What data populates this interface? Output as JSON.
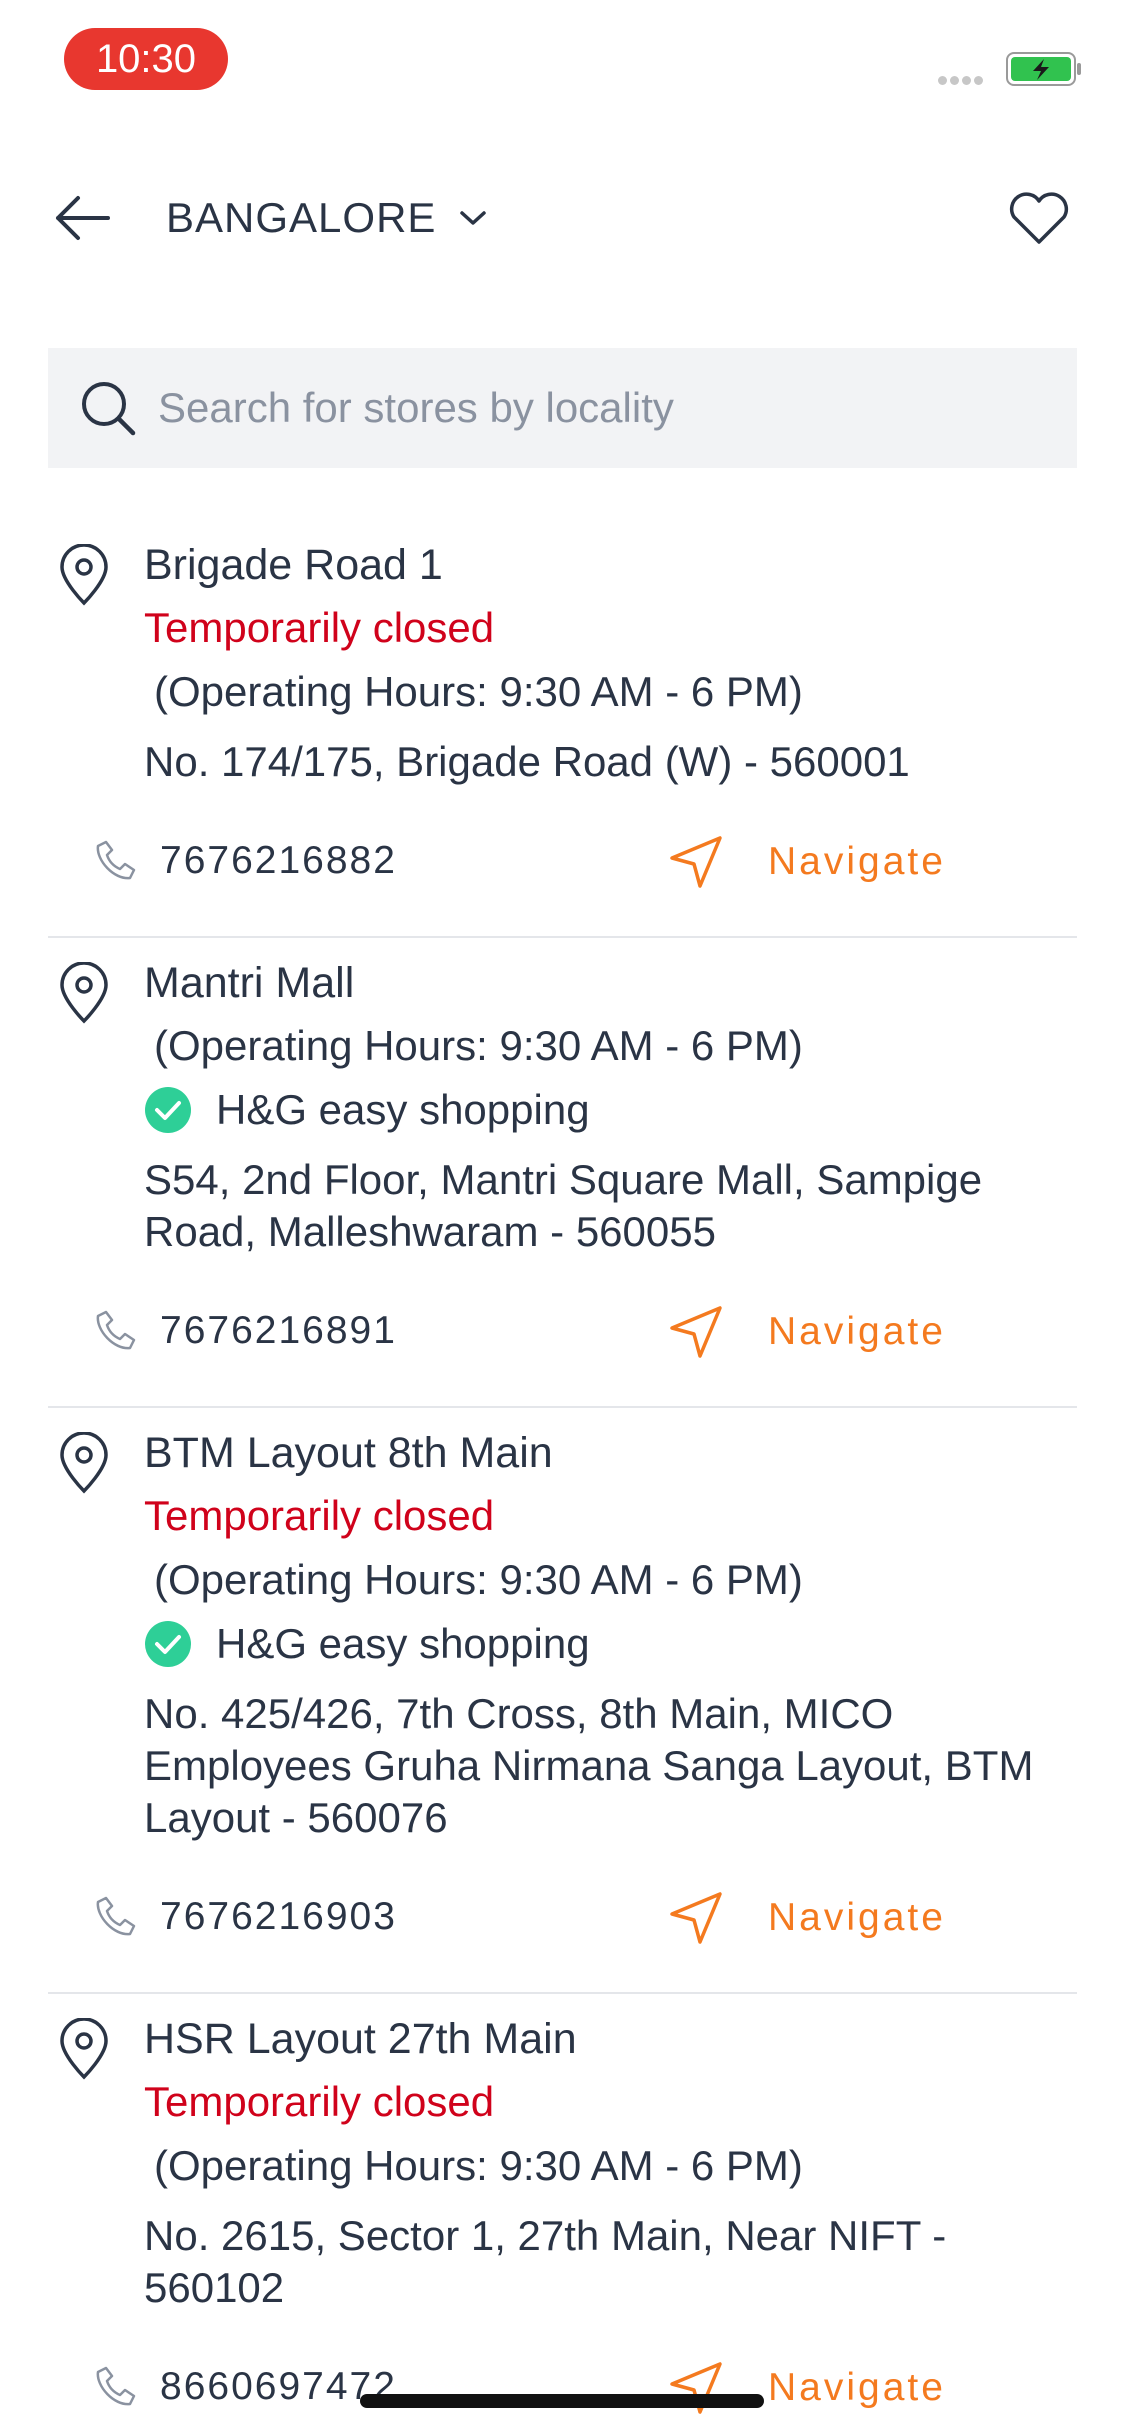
{
  "status_bar": {
    "time": "10:30"
  },
  "header": {
    "city": "BANGALORE"
  },
  "search": {
    "placeholder": "Search for stores by locality"
  },
  "stores": [
    {
      "name": "Brigade Road 1",
      "status": "Temporarily closed",
      "hours": "(Operating Hours: 9:30 AM - 6 PM)",
      "easy_shopping": "",
      "address": "No. 174/175, Brigade Road (W) - 560001",
      "phone": "7676216882",
      "navigate": "Navigate"
    },
    {
      "name": "Mantri Mall",
      "status": "",
      "hours": "(Operating Hours: 9:30 AM - 6 PM)",
      "easy_shopping": "H&G easy shopping",
      "address": "S54, 2nd Floor, Mantri Square Mall, Sampige Road, Malleshwaram - 560055",
      "phone": "7676216891",
      "navigate": "Navigate"
    },
    {
      "name": "BTM Layout 8th Main",
      "status": "Temporarily closed",
      "hours": "(Operating Hours: 9:30 AM - 6 PM)",
      "easy_shopping": "H&G easy shopping",
      "address": "No. 425/426, 7th Cross, 8th Main, MICO Employees Gruha Nirmana Sanga Layout, BTM Layout - 560076",
      "phone": "7676216903",
      "navigate": "Navigate"
    },
    {
      "name": "HSR Layout 27th Main",
      "status": "Temporarily closed",
      "hours": "(Operating Hours: 9:30 AM - 6 PM)",
      "easy_shopping": "",
      "address": "No. 2615, Sector 1, 27th Main, Near NIFT - 560102",
      "phone": "8660697472",
      "navigate": "Navigate"
    }
  ],
  "colors": {
    "accent": "#f47a1f",
    "closed": "#d0021b",
    "check": "#2ecf97",
    "text": "#2a3445"
  },
  "icons": [
    "back-arrow-icon",
    "chevron-down-icon",
    "heart-icon",
    "search-icon",
    "location-pin-icon",
    "check-circle-icon",
    "phone-icon",
    "navigate-arrow-icon"
  ]
}
